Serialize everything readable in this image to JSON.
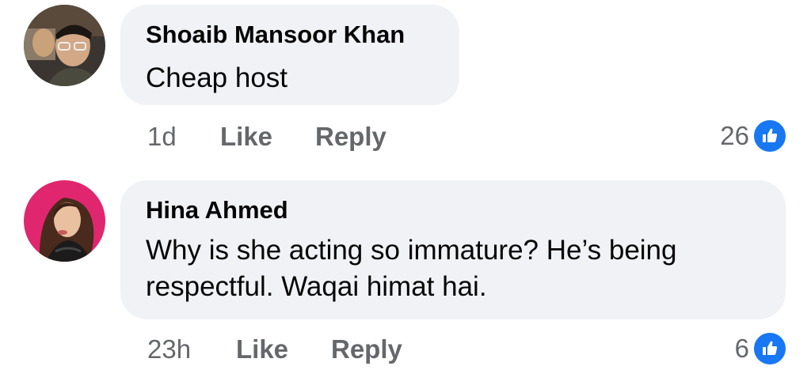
{
  "comments": [
    {
      "author": "Shoaib Mansoor Khan",
      "text": "Cheap host",
      "time": "1d",
      "like_label": "Like",
      "reply_label": "Reply",
      "reaction_count": "26",
      "reaction_icon": "like-icon"
    },
    {
      "author": "Hina Ahmed",
      "text": "Why is she acting so immature? He’s being respectful. Waqai himat hai.",
      "time": "23h",
      "like_label": "Like",
      "reply_label": "Reply",
      "reaction_count": "6",
      "reaction_icon": "like-icon"
    }
  ],
  "colors": {
    "bubble": "#f0f2f5",
    "meta_text": "#65676b",
    "like_blue": "#1877f2"
  }
}
